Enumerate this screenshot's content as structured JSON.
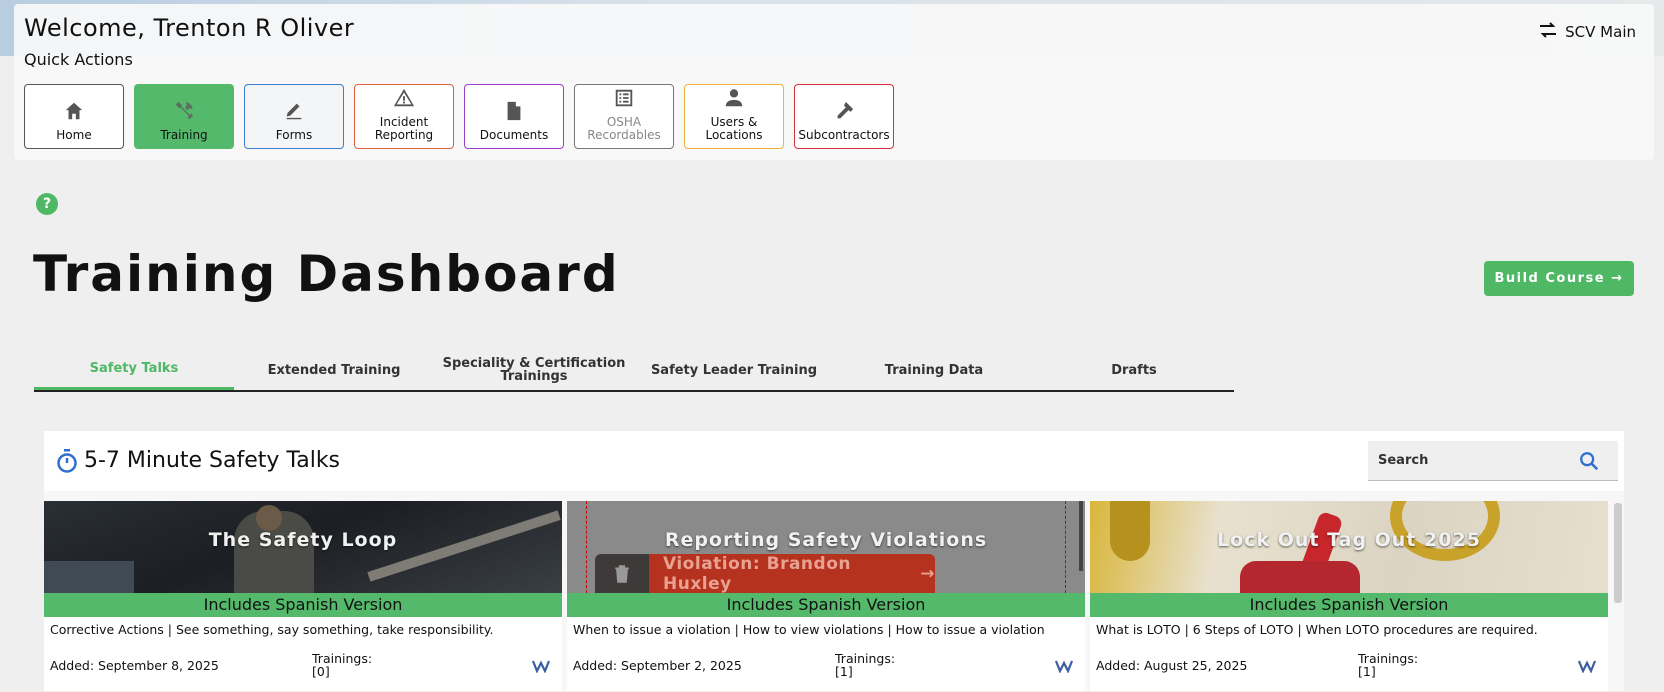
{
  "header": {
    "welcome": "Welcome, Trenton R Oliver",
    "quick_actions_label": "Quick Actions",
    "location_switch": "SCV Main"
  },
  "quick_actions": [
    {
      "label": "Home",
      "icon": "home-icon"
    },
    {
      "label": "Training",
      "icon": "tools-icon",
      "active": true
    },
    {
      "label": "Forms",
      "icon": "pen-icon"
    },
    {
      "label": "Incident Reporting",
      "icon": "warning-icon"
    },
    {
      "label": "Documents",
      "icon": "document-icon"
    },
    {
      "label": "OSHA Recordables",
      "icon": "list-icon"
    },
    {
      "label": "Users & Locations",
      "icon": "user-icon"
    },
    {
      "label": "Subcontractors",
      "icon": "wrench-icon"
    }
  ],
  "page": {
    "title": "Training Dashboard",
    "build_course": "Build Course →"
  },
  "tabs": [
    {
      "label": "Safety Talks",
      "active": true
    },
    {
      "label": "Extended Training"
    },
    {
      "label": "Speciality & Certification Trainings"
    },
    {
      "label": "Safety Leader Training"
    },
    {
      "label": "Training Data"
    },
    {
      "label": "Drafts"
    }
  ],
  "panel": {
    "title": "5-7 Minute Safety Talks",
    "search_placeholder": "Search"
  },
  "cards": [
    {
      "title": "The Safety Loop",
      "badge": "Includes Spanish Version",
      "description": "Corrective Actions | See something, say something, take responsibility.",
      "added": "Added: September 8, 2025",
      "trainings_label": "Trainings:",
      "trainings_count": "[0]"
    },
    {
      "title": "Reporting Safety Violations",
      "badge": "Includes Spanish Version",
      "description": "When to issue a violation | How to view violations | How to issue a violation",
      "added": "Added: September 2, 2025",
      "trainings_label": "Trainings:",
      "trainings_count": "[1]",
      "overlay_text": "Violation: Brandon Huxley"
    },
    {
      "title": "Lock Out Tag Out 2025",
      "badge": "Includes Spanish Version",
      "description": "What is LOTO | 6 Steps of LOTO | When LOTO procedures are required.",
      "added": "Added: August 25, 2025",
      "trainings_label": "Trainings:",
      "trainings_count": "[1]"
    }
  ],
  "colors": {
    "brand_green": "#4fb865",
    "forms_blue": "#3c7fd1",
    "incident_orange": "#e0603c",
    "documents_purple": "#9b3fc1",
    "users_yellow": "#f0b23a",
    "subcontractors_red": "#d6303c"
  }
}
